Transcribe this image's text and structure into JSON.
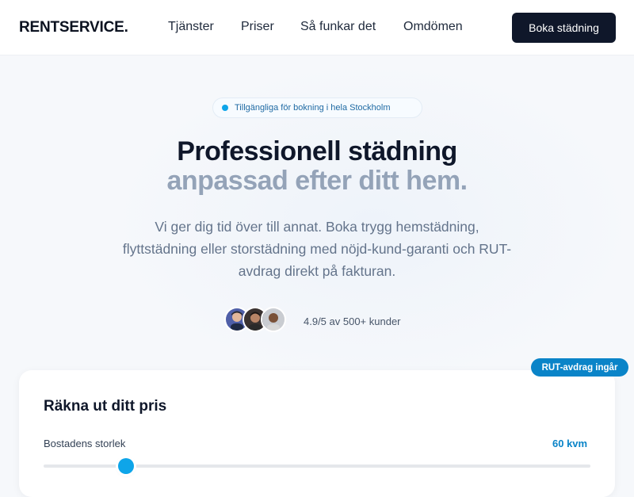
{
  "header": {
    "logo": "RENTSERVICE.",
    "nav": [
      "Tjänster",
      "Priser",
      "Så funkar det",
      "Omdömen"
    ],
    "cta_label": "Boka städning"
  },
  "hero": {
    "badge": "Tillgängliga för bokning i hela Stockholm",
    "title_line1": "Professionell städning",
    "title_line2": "anpassad efter ditt hem.",
    "subtitle": "Vi ger dig tid över till annat. Boka trygg hemstädning, flyttstädning eller storstädning med nöjd-kund-garanti och RUT-avdrag direkt på fakturan.",
    "rating": "4.9/5 av 500+ kunder"
  },
  "calculator": {
    "badge": "RUT-avdrag ingår",
    "title": "Räkna ut ditt pris",
    "size_label": "Bostadens storlek",
    "size_value": "60 kvm",
    "slider_fraction": 0.15
  },
  "colors": {
    "primary_dark": "#0f172a",
    "accent": "#0a84c8",
    "muted_title": "#94a3b8"
  }
}
